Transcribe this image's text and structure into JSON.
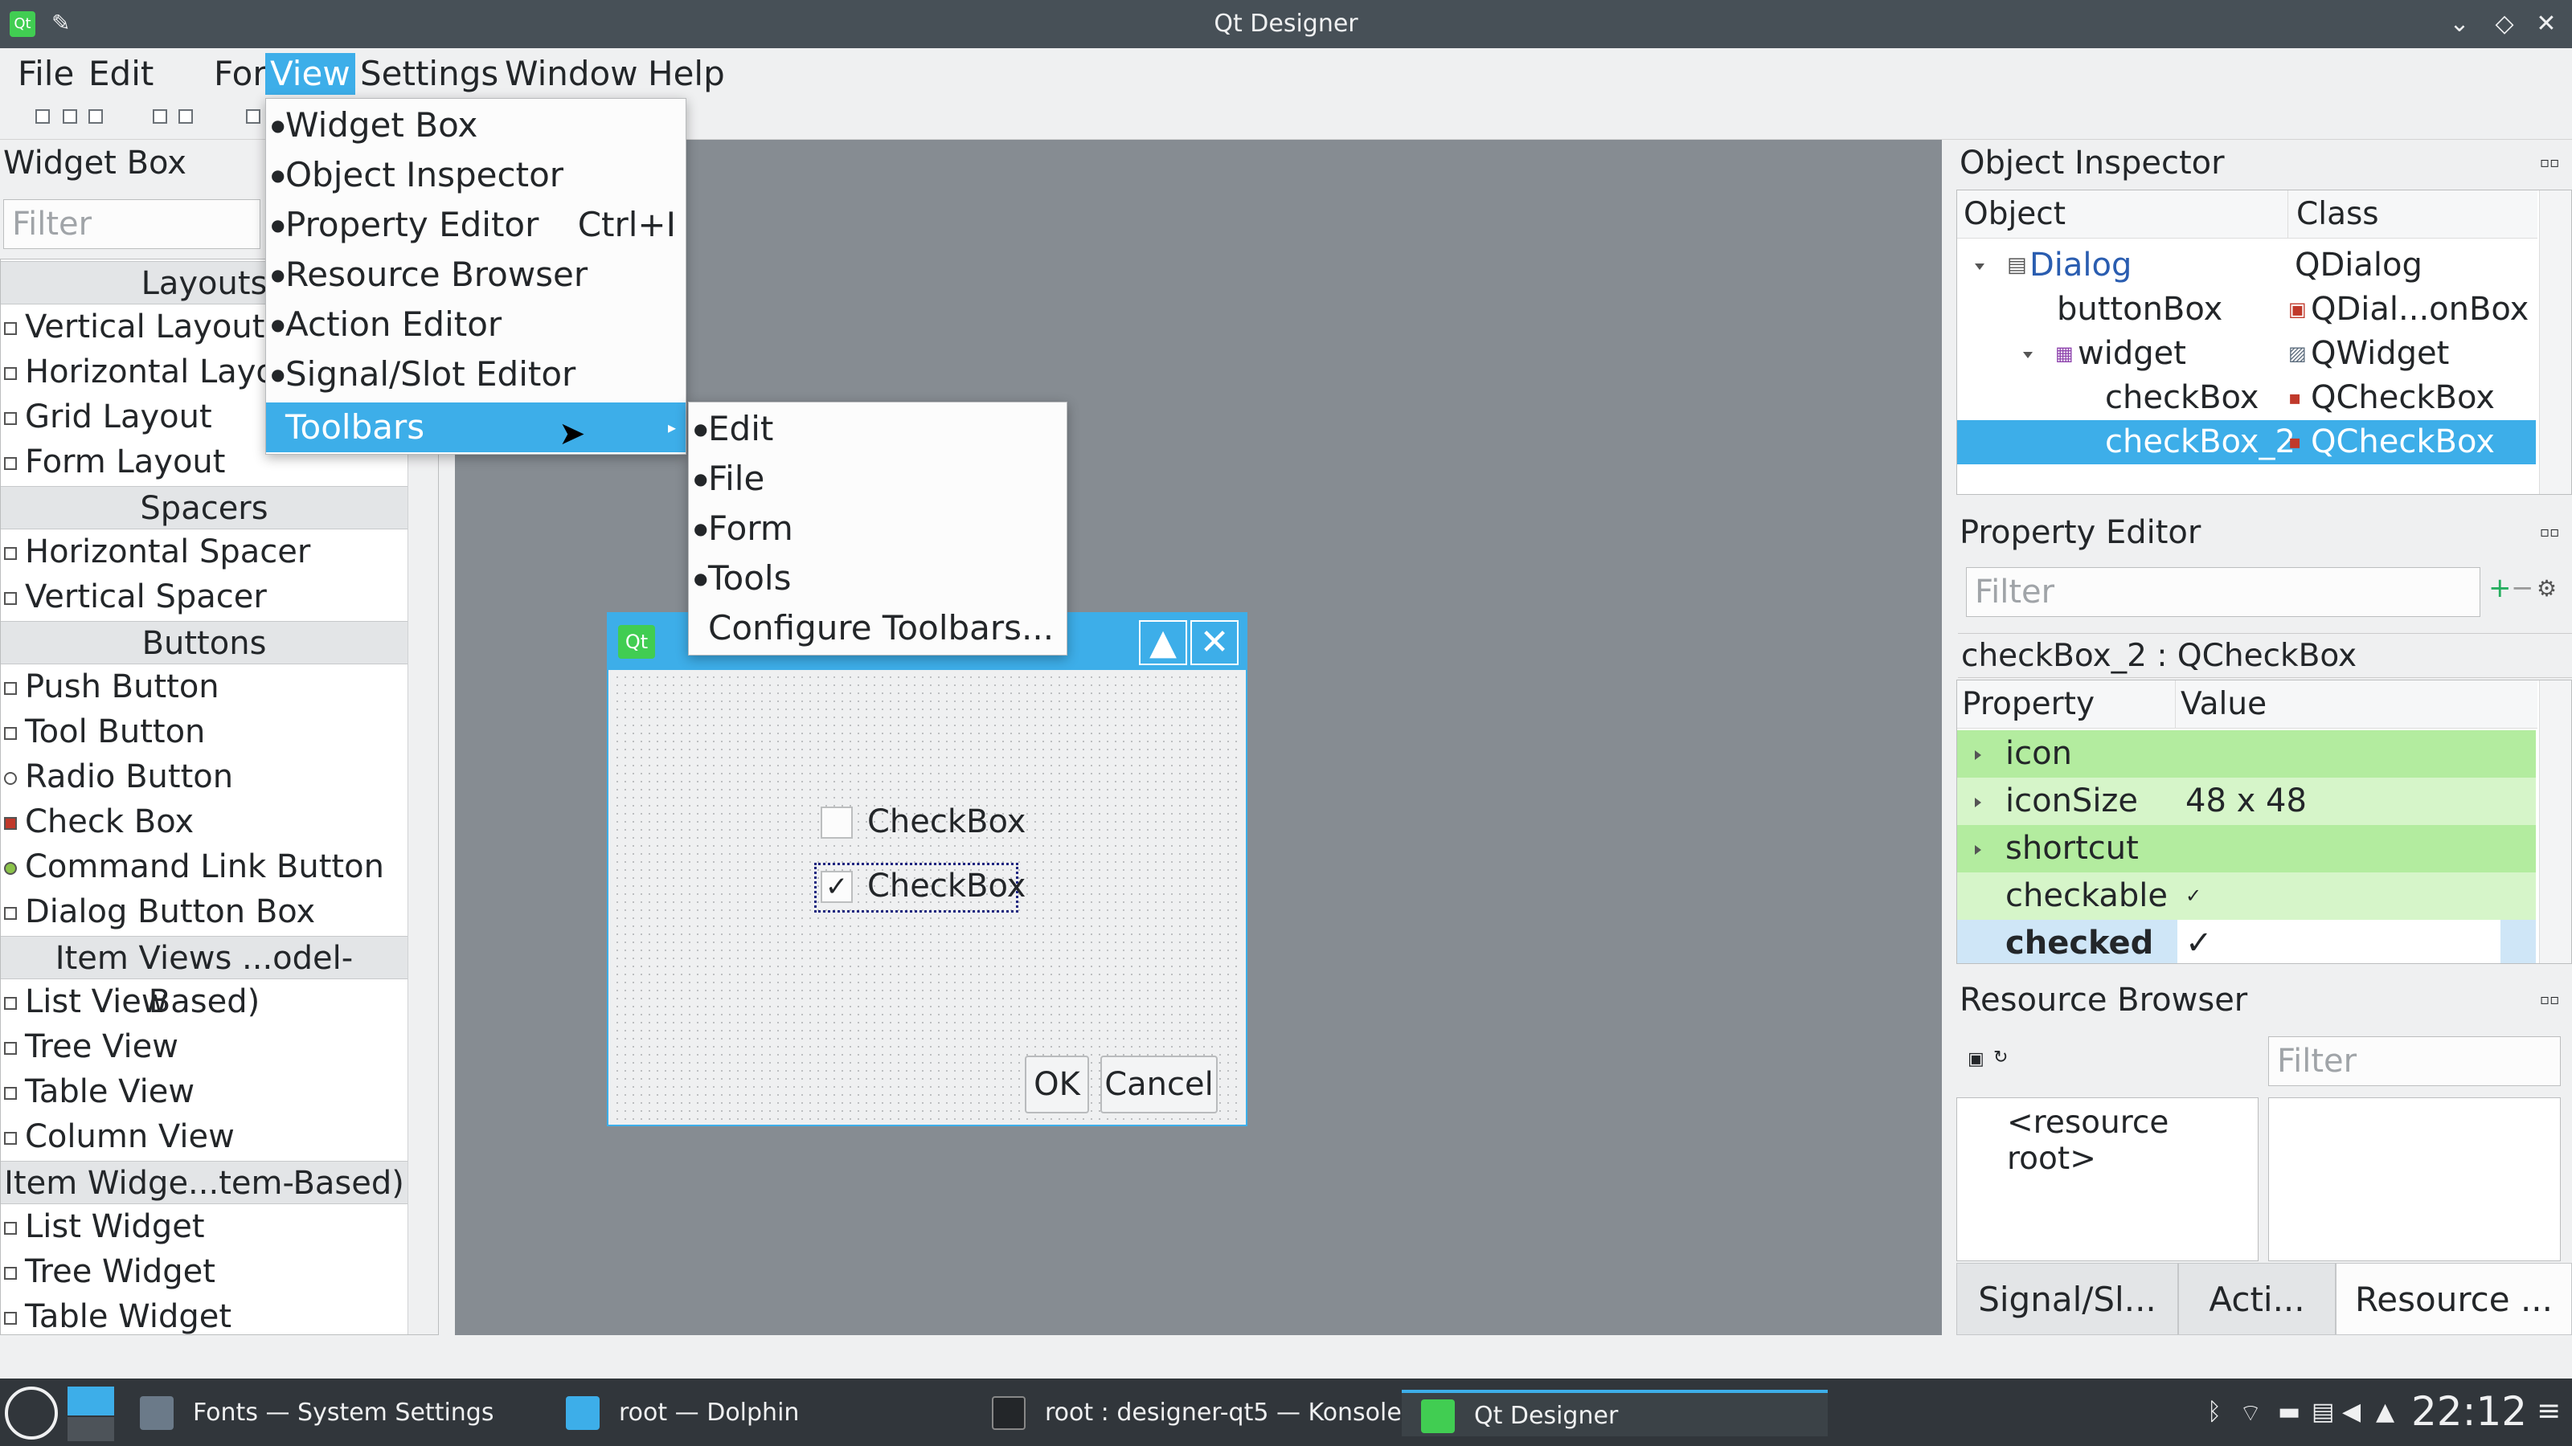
{
  "window": {
    "title": "Qt Designer"
  },
  "menubar": [
    {
      "label": "File"
    },
    {
      "label": "Edit"
    },
    {
      "label": "Form"
    },
    {
      "label": "View"
    },
    {
      "label": "Settings"
    },
    {
      "label": "Window"
    },
    {
      "label": "Help"
    }
  ],
  "view_menu": {
    "items": [
      {
        "label": "Widget Box",
        "shortcut": ""
      },
      {
        "label": "Object Inspector",
        "shortcut": ""
      },
      {
        "label": "Property Editor",
        "shortcut": "Ctrl+I"
      },
      {
        "label": "Resource Browser",
        "shortcut": ""
      },
      {
        "label": "Action Editor",
        "shortcut": ""
      },
      {
        "label": "Signal/Slot Editor",
        "shortcut": ""
      },
      {
        "label": "Toolbars",
        "shortcut": ""
      }
    ]
  },
  "toolbars_submenu": {
    "items": [
      {
        "label": "Edit"
      },
      {
        "label": "File"
      },
      {
        "label": "Form"
      },
      {
        "label": "Tools"
      },
      {
        "label": "Configure Toolbars..."
      }
    ]
  },
  "widget_box": {
    "title": "Widget Box",
    "filter_placeholder": "Filter",
    "categories": {
      "layouts": "Layouts",
      "spacers": "Spacers",
      "buttons": "Buttons",
      "item_views": "Item Views ...odel-Based)",
      "item_widgets": "Item Widge...tem-Based)"
    },
    "layouts": [
      "Vertical Layout",
      "Horizontal Layo",
      "Grid Layout",
      "Form Layout"
    ],
    "spacers": [
      "Horizontal Spacer",
      "Vertical Spacer"
    ],
    "buttons": [
      "Push Button",
      "Tool Button",
      "Radio Button",
      "Check Box",
      "Command Link Button",
      "Dialog Button Box"
    ],
    "item_views": [
      "List View",
      "Tree View",
      "Table View",
      "Column View"
    ],
    "item_widgets": [
      "List Widget",
      "Tree Widget",
      "Table Widget"
    ]
  },
  "form": {
    "checkbox1": {
      "label": "CheckBox",
      "checked": false
    },
    "checkbox2": {
      "label": "CheckBox",
      "checked": true
    },
    "ok_label": "OK",
    "cancel_label": "Cancel"
  },
  "object_inspector": {
    "title": "Object Inspector",
    "col_object": "Object",
    "col_class": "Class",
    "rows": [
      {
        "object": "Dialog",
        "class": "QDialog"
      },
      {
        "object": "buttonBox",
        "class": "QDial...onBox"
      },
      {
        "object": "widget",
        "class": "QWidget"
      },
      {
        "object": "checkBox",
        "class": "QCheckBox"
      },
      {
        "object": "checkBox_2",
        "class": "QCheckBox"
      }
    ]
  },
  "property_editor": {
    "title": "Property Editor",
    "filter_placeholder": "Filter",
    "selected_object": "checkBox_2 : QCheckBox",
    "col_property": "Property",
    "col_value": "Value",
    "rows": [
      {
        "name": "icon",
        "value": ""
      },
      {
        "name": "iconSize",
        "value": "48 x 48"
      },
      {
        "name": "shortcut",
        "value": ""
      },
      {
        "name": "checkable",
        "value": "✓"
      },
      {
        "name": "checked",
        "value": "✓"
      }
    ]
  },
  "resource_browser": {
    "title": "Resource Browser",
    "filter_placeholder": "Filter",
    "root": "<resource root>"
  },
  "bottom_tabs": [
    "Signal/Sl...",
    "Acti...",
    "Resource ..."
  ],
  "taskbar": {
    "tasks": [
      {
        "label": "Fonts  — System Settings"
      },
      {
        "label": "root — Dolphin"
      },
      {
        "label": "root : designer-qt5 — Konsole"
      },
      {
        "label": "Qt Designer"
      }
    ],
    "clock": "22:12"
  },
  "colors": {
    "accent": "#3daee9",
    "property_highlight": "#c8f0c0",
    "panel_bg": "#eff0f1",
    "taskbar_bg": "#31363b"
  }
}
